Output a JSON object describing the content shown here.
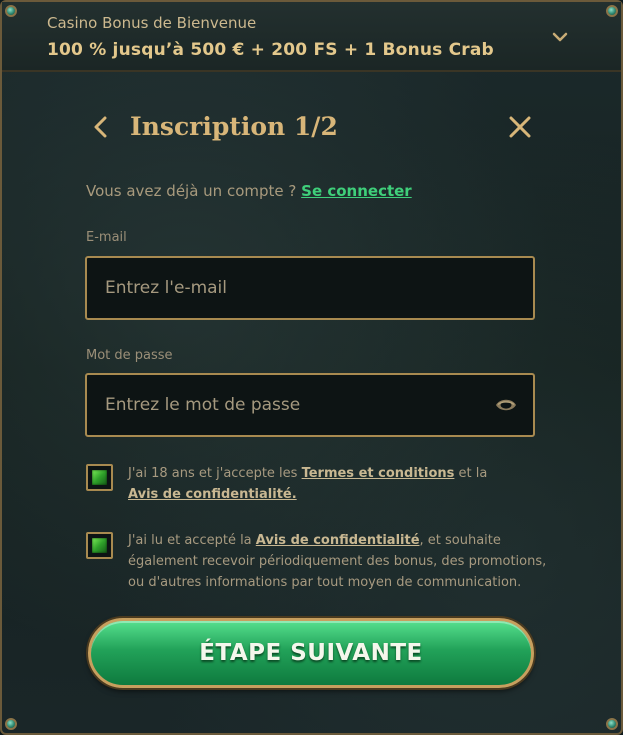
{
  "bonus": {
    "title": "Casino Bonus de Bienvenue",
    "offer": "100 % jusqu’à 500 € + 200 FS + 1 Bonus Crab",
    "toggle_icon": "chevron-down-icon"
  },
  "form": {
    "title": "Inscription 1/2",
    "back_icon": "chevron-left-icon",
    "close_icon": "close-icon",
    "account_prompt": "Vous avez déjà un compte ?",
    "login_link": "Se connecter"
  },
  "email": {
    "label": "E-mail",
    "placeholder": "Entrez l'e-mail",
    "value": ""
  },
  "password": {
    "label": "Mot de passe",
    "placeholder": "Entrez le mot de passe",
    "value": "",
    "toggle_icon": "eye-icon"
  },
  "consent_age": {
    "checked": true,
    "text_before": "J'ai 18 ans et j'accepte les ",
    "terms_link": "Termes et conditions",
    "text_middle": " et la ",
    "privacy_link": "Avis de confidentialité."
  },
  "consent_marketing": {
    "checked": true,
    "text_before": "J'ai lu et accepté la ",
    "privacy_link": "Avis de confidentialité",
    "text_after": ", et souhaite également recevoir périodiquement des bonus, des promotions, ou d'autres informations par tout moyen de communication."
  },
  "submit": {
    "label": "ÉTAPE SUIVANTE"
  },
  "colors": {
    "accent_gold": "#d8b679",
    "link_green": "#3fcf7a",
    "button_green": "#22a259",
    "border_gold": "#a88a50",
    "background": "#1a2628"
  }
}
